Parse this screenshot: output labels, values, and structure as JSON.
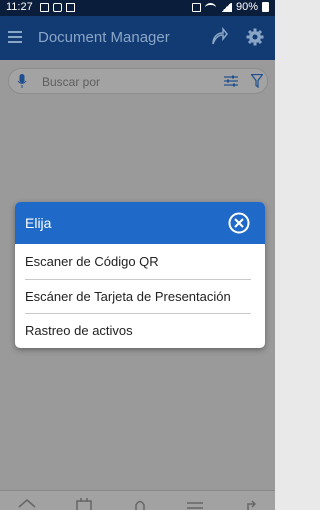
{
  "status_bar": {
    "time": "11:27",
    "battery": "90%",
    "left_icons": [
      "image-icon",
      "message-icon",
      "mail-icon"
    ],
    "right_icons": [
      "nfc-icon",
      "wifi-icon",
      "signal-icon",
      "battery-icon"
    ]
  },
  "app_bar": {
    "title": "Document Manager",
    "icons": [
      "menu-icon",
      "share-icon",
      "gear-icon"
    ]
  },
  "search": {
    "placeholder": "Buscar por",
    "icons": [
      "mic-icon",
      "sliders-icon",
      "filter-icon"
    ]
  },
  "dialog": {
    "title": "Elija",
    "options": [
      "Escaner de Código QR",
      "Escáner de Tarjeta de Presentación",
      "Rastreo de activos"
    ]
  },
  "bottom_nav": {
    "icons": [
      "home-icon",
      "calendar-icon",
      "bell-icon",
      "list-icon",
      "export-icon"
    ]
  },
  "colors": {
    "status_bar": "#0a1d3a",
    "app_bar": "#123a73",
    "dialog_header": "#1f69c8",
    "overlay": "#9a9a9a"
  }
}
